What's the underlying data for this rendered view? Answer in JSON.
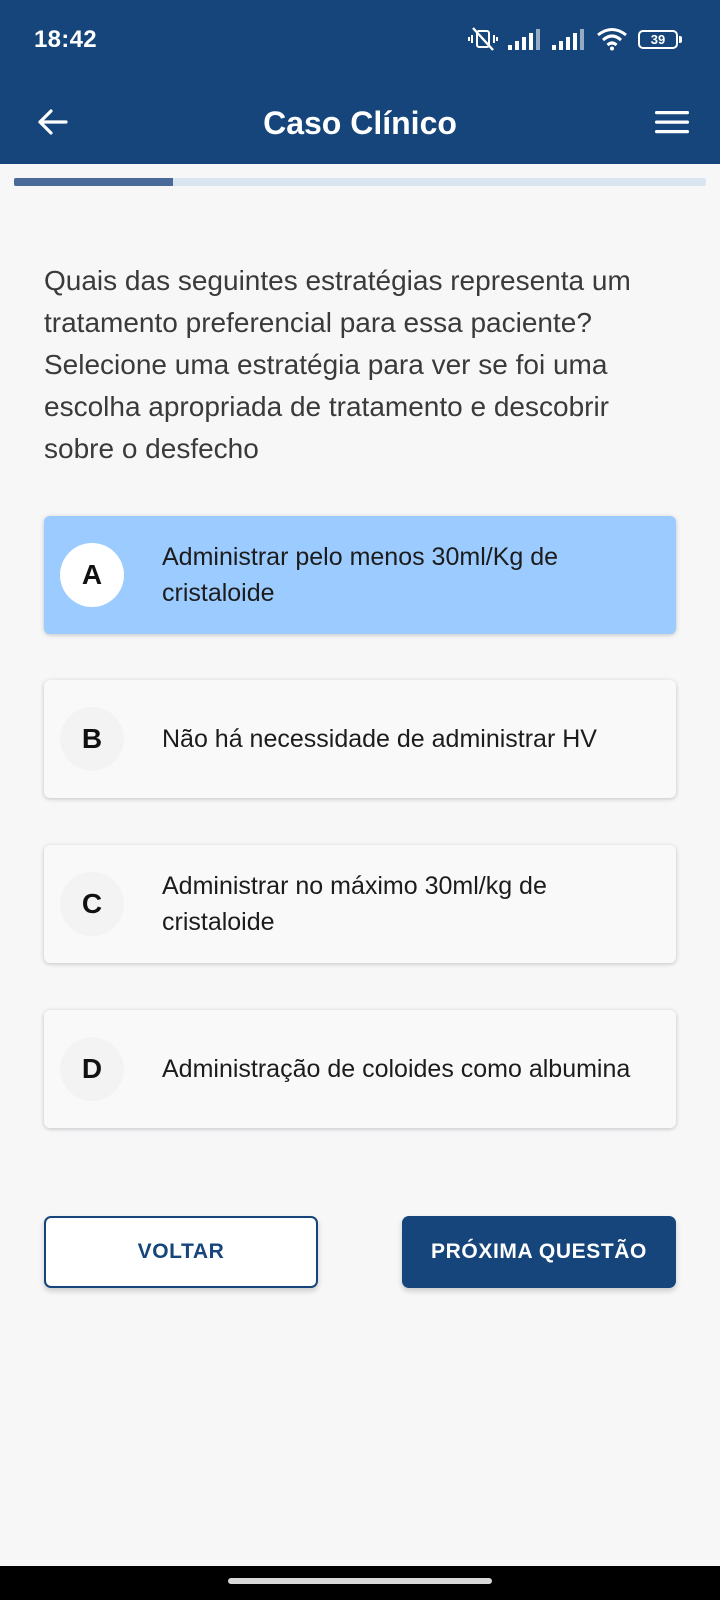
{
  "status_bar": {
    "time": "18:42",
    "battery": "39",
    "icons": [
      "vibrate-off-icon",
      "signal-icon",
      "signal-icon",
      "wifi-icon",
      "battery-icon"
    ]
  },
  "app_bar": {
    "title": "Caso Clínico",
    "back_icon": "arrow-left-icon",
    "menu_icon": "hamburger-menu-icon"
  },
  "progress": {
    "fraction": 0.23
  },
  "question": "Quais das seguintes estratégias representa um tratamento preferencial para essa paciente? Selecione uma estratégia para ver se foi uma escolha apropriada de tratamento e descobrir sobre o desfecho",
  "options": [
    {
      "letter": "A",
      "text": "Administrar pelo menos 30ml/Kg de cristaloide",
      "selected": true
    },
    {
      "letter": "B",
      "text": "Não há necessidade de administrar HV",
      "selected": false
    },
    {
      "letter": "C",
      "text": "Administrar no máximo 30ml/kg de cristaloide",
      "selected": false
    },
    {
      "letter": "D",
      "text": "Administração de coloides como albumina",
      "selected": false
    }
  ],
  "buttons": {
    "back_label": "VOLTAR",
    "next_label": "PRÓXIMA QUESTÃO"
  },
  "colors": {
    "primary": "#15457a",
    "selected_option": "#9bcbff",
    "progress_track": "#dbe5f2",
    "progress_fill": "#4a6a99"
  }
}
